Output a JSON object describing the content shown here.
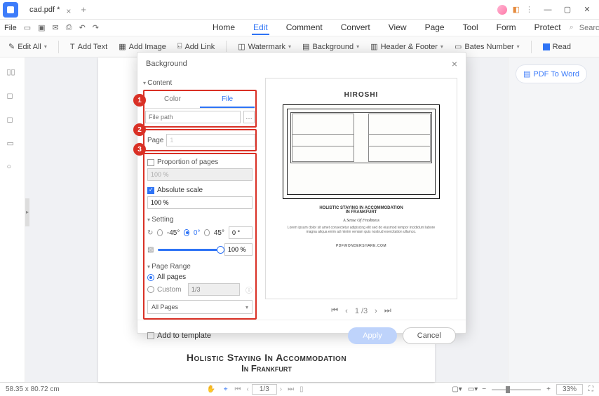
{
  "titlebar": {
    "tab_name": "cad.pdf *"
  },
  "file_menu": "File",
  "menutabs": [
    "Home",
    "Edit",
    "Comment",
    "Convert",
    "View",
    "Page",
    "Tool",
    "Form",
    "Protect"
  ],
  "search_placeholder": "Search Tools",
  "ribbon": {
    "edit_all": "Edit All",
    "add_text": "Add Text",
    "add_image": "Add Image",
    "add_link": "Add Link",
    "watermark": "Watermark",
    "background": "Background",
    "header_footer": "Header & Footer",
    "bates": "Bates Number",
    "read": "Read"
  },
  "right_panel": {
    "pdf_to_word": "PDF To Word"
  },
  "dialog": {
    "title": "Background",
    "content": "Content",
    "color_tab": "Color",
    "file_tab": "File",
    "file_placeholder": "File path",
    "page_label": "Page",
    "page_value": "1",
    "prop_label": "Proportion of pages",
    "prop_value": "100 %",
    "abs_label": "Absolute scale",
    "abs_value": "100 %",
    "setting": "Setting",
    "rot_n45": "-45°",
    "rot_0": "0°",
    "rot_45": "45°",
    "rot_value": "0 °",
    "opacity_value": "100 %",
    "page_range": "Page Range",
    "all_pages": "All pages",
    "custom": "Custom",
    "custom_hint": "1/3",
    "all_pages_select": "All Pages",
    "add_to_template": "Add to template",
    "apply": "Apply",
    "cancel": "Cancel",
    "pager": "1 /3"
  },
  "bullets": {
    "one": "1",
    "two": "2",
    "three": "3"
  },
  "preview": {
    "title": "HIROSHI",
    "line1": "HOLISTIC STAYING IN ACCOMMODATION",
    "line2": "IN FRANKFURT",
    "scriptline": "A Sense Of Freshness",
    "website": "PDFWONDERSHARE.COM"
  },
  "doc": {
    "line1": "Holistic Staying In Accommodation",
    "line2": "In Frankfurt"
  },
  "status": {
    "dims": "58.35 x 80.72 cm",
    "page": "1/3",
    "zoom": "33%"
  }
}
